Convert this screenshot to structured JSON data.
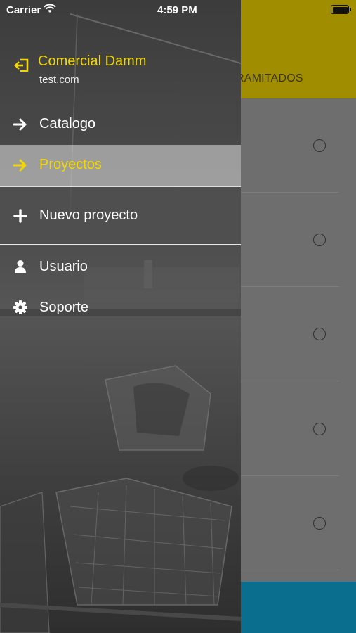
{
  "status_bar": {
    "carrier": "Carrier",
    "time": "4:59 PM"
  },
  "background_screen": {
    "tab_partial_label": "RAMITADOS",
    "rows": 5,
    "colors": {
      "header": "#a08d00",
      "list": "#6e6e6e",
      "footer": "#0a6e8f"
    }
  },
  "drawer": {
    "user": {
      "name": "Comercial Damm",
      "email": "test.com",
      "icon": "logout-icon"
    },
    "items": [
      {
        "label": "Catalogo",
        "icon": "arrow-right-icon",
        "selected": false
      },
      {
        "label": "Proyectos",
        "icon": "arrow-right-icon",
        "selected": true
      },
      {
        "label": "Nuevo proyecto",
        "icon": "plus-icon",
        "selected": false
      },
      {
        "label": "Usuario",
        "icon": "user-icon",
        "selected": false
      },
      {
        "label": "Soporte",
        "icon": "gear-icon",
        "selected": false
      }
    ],
    "colors": {
      "accent": "#f2d800",
      "text": "#ffffff"
    }
  }
}
